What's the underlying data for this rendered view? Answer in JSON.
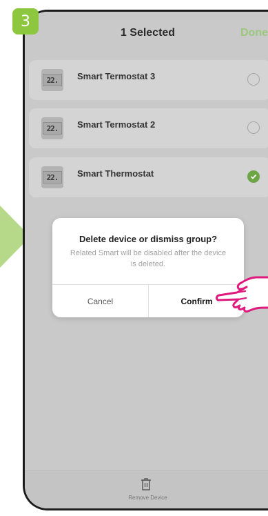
{
  "step_number": "3",
  "header": {
    "title": "1  Selected",
    "done_label": "Done"
  },
  "devices": [
    {
      "name": "Smart Termostat 3",
      "display": "22.",
      "selected": false
    },
    {
      "name": "Smart Termostat 2",
      "display": "22.",
      "selected": false
    },
    {
      "name": "Smart Thermostat",
      "display": "22.",
      "selected": true
    }
  ],
  "dialog": {
    "title": "Delete device or dismiss group?",
    "message": "Related Smart will be disabled after the device is deleted.",
    "cancel_label": "Cancel",
    "confirm_label": "Confirm"
  },
  "bottom_bar": {
    "remove_label": "Remove Device",
    "icon": "trash-icon"
  },
  "colors": {
    "accent_green": "#8dc63f",
    "check_green": "#6ea544",
    "hand_pink": "#e0197d"
  }
}
